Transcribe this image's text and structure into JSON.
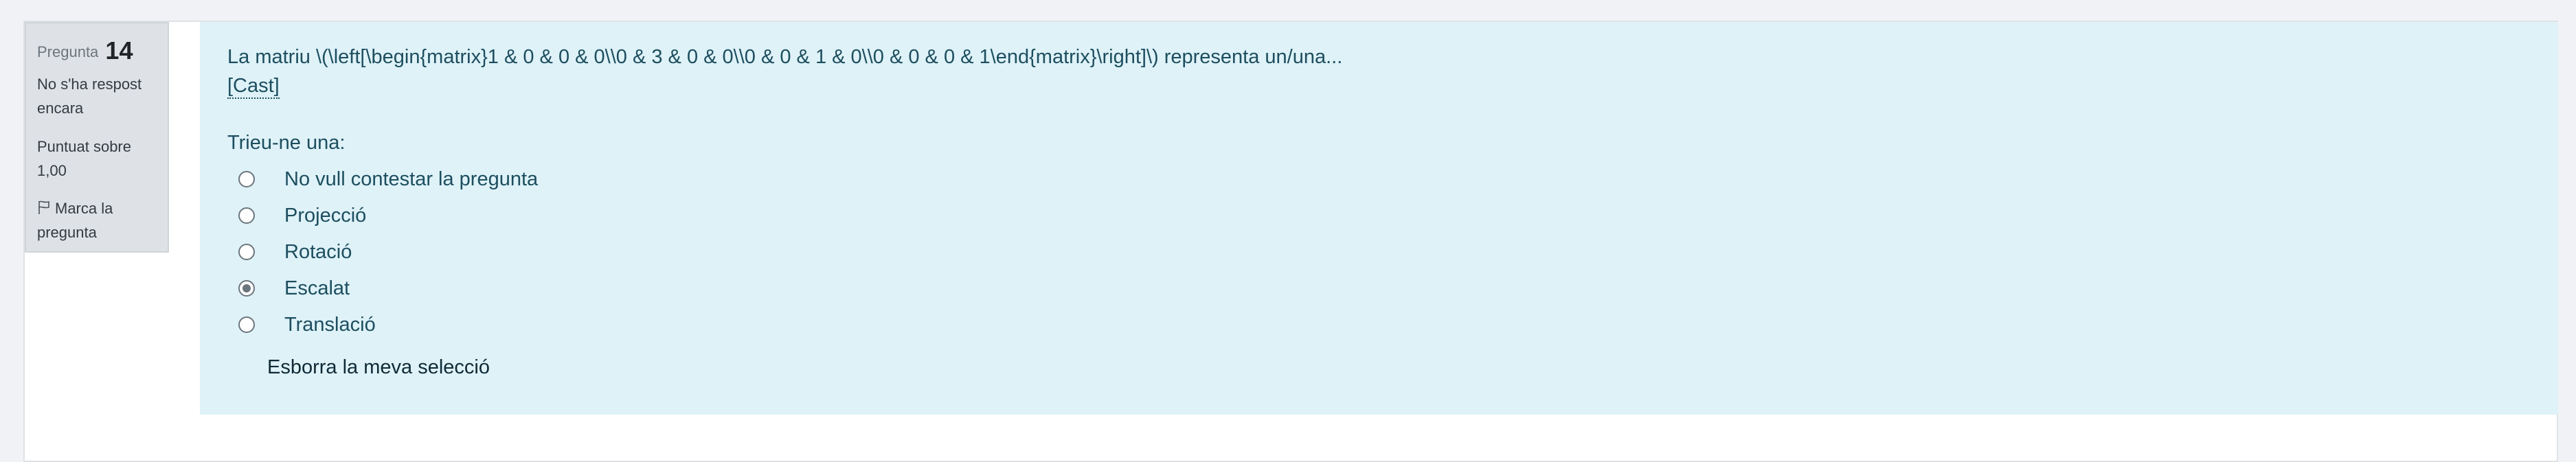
{
  "info": {
    "question_word": "Pregunta",
    "question_number": "14",
    "state": "No s'ha respost encara",
    "grade": "Puntuat sobre 1,00",
    "flag_label": "Marca la pregunta",
    "flag_icon": "flag-icon"
  },
  "question": {
    "text": "La matriu \\(\\left[\\begin{matrix}1 & 0 & 0 & 0\\\\0 & 3 & 0 & 0\\\\0 & 0 & 1 & 0\\\\0 & 0 & 0 & 1\\end{matrix}\\right]\\) representa un/una...",
    "lang_link": "[Cast]",
    "prompt": "Trieu-ne una:",
    "options": [
      {
        "label": "No vull contestar la pregunta",
        "selected": false
      },
      {
        "label": "Projecció",
        "selected": false
      },
      {
        "label": "Rotació",
        "selected": false
      },
      {
        "label": "Escalat",
        "selected": true
      },
      {
        "label": "Translació",
        "selected": false
      }
    ],
    "clear_label": "Esborra la meva selecció"
  },
  "colors": {
    "content_bg": "#def2f8",
    "info_bg": "#dee2e6",
    "text": "#1d4e5f"
  }
}
